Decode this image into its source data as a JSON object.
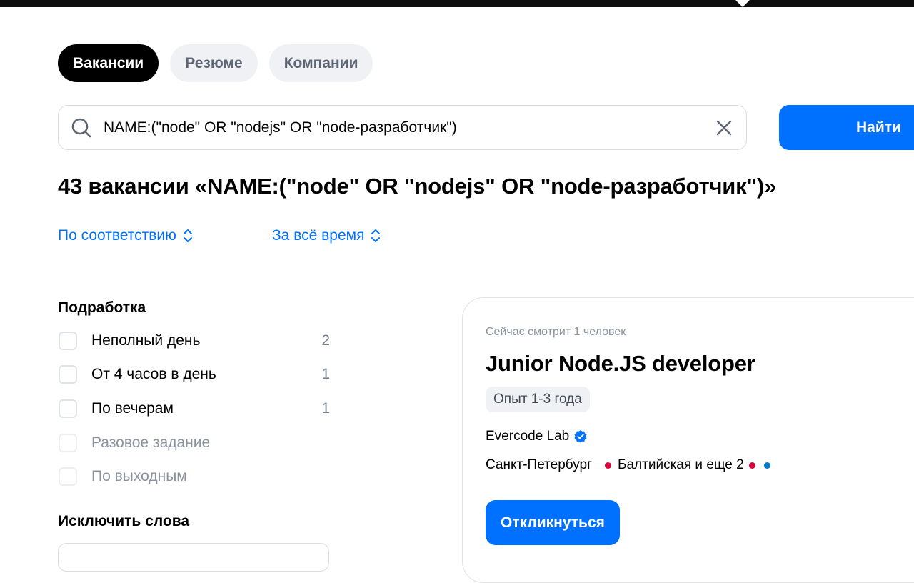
{
  "tabs": [
    {
      "label": "Вакансии",
      "active": true
    },
    {
      "label": "Резюме",
      "active": false
    },
    {
      "label": "Компании",
      "active": false
    }
  ],
  "search": {
    "value": "NAME:(\"node\" OR \"nodejs\" OR \"node-разработчик\")",
    "search_icon": "search-icon",
    "clear_icon": "close-icon",
    "button_label": "Найти"
  },
  "results": {
    "title": "43 вакансии «NAME:(\"node\" OR \"nodejs\" OR \"node-разработчик\")»"
  },
  "sorting": {
    "relevance_label": "По соответствию",
    "period_label": "За всё время"
  },
  "filters": {
    "parttime": {
      "title": "Подработка",
      "options": [
        {
          "label": "Неполный день",
          "count": "2",
          "enabled": true
        },
        {
          "label": "От 4 часов в день",
          "count": "1",
          "enabled": true
        },
        {
          "label": "По вечерам",
          "count": "1",
          "enabled": true
        },
        {
          "label": "Разовое задание",
          "count": "",
          "enabled": false
        },
        {
          "label": "По выходным",
          "count": "",
          "enabled": false
        }
      ]
    },
    "exclude": {
      "title": "Исключить слова"
    }
  },
  "vacancy": {
    "viewers": "Сейчас смотрит 1 человек",
    "title": "Junior Node.JS developer",
    "experience": "Опыт 1-3 года",
    "company": "Evercode Lab",
    "city": "Санкт-Петербург",
    "metro": "Балтийская и еще 2",
    "apply_label": "Откликнуться"
  },
  "colors": {
    "accent": "#0070ff",
    "metro_red": "#d6043b",
    "metro_blue": "#0078c9"
  }
}
